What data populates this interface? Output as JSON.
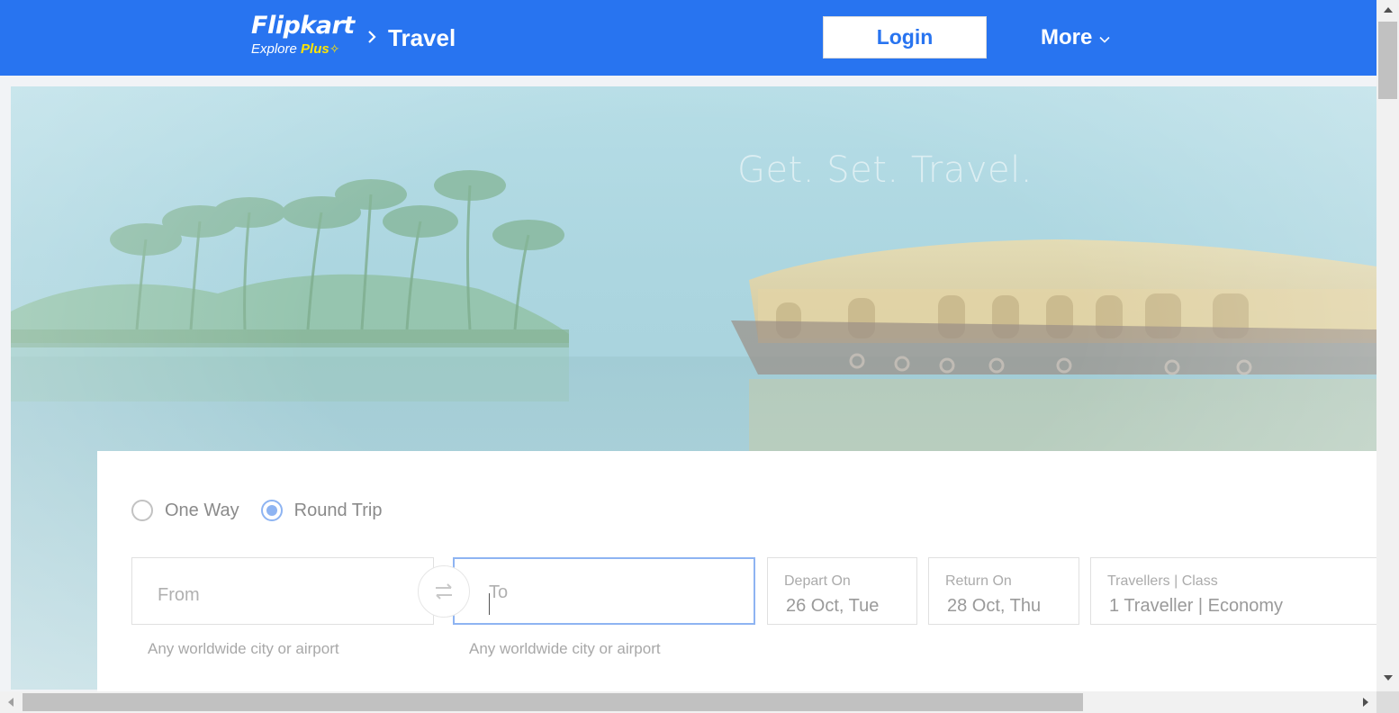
{
  "header": {
    "logo_main": "Flipkart",
    "logo_sub_explore": "Explore",
    "logo_sub_plus": "Plus",
    "breadcrumb_title": "Travel",
    "login_label": "Login",
    "more_label": "More",
    "brand_color": "#2874f0",
    "accent_color": "#ffe500"
  },
  "hero": {
    "tagline": "Get. Set. Travel."
  },
  "search": {
    "trip_types": [
      {
        "label": "One Way",
        "selected": false
      },
      {
        "label": "Round Trip",
        "selected": true
      }
    ],
    "from_placeholder": "From",
    "to_placeholder": "To",
    "from_hint": "Any worldwide city or airport",
    "to_hint": "Any worldwide city or airport",
    "depart_label": "Depart On",
    "depart_value": "26 Oct, Tue",
    "return_label": "Return On",
    "return_value": "28 Oct, Thu",
    "travellers_label": "Travellers | Class",
    "travellers_value": "1 Traveller | Economy"
  },
  "icons": {
    "breadcrumb_separator": "chevron-right-icon",
    "more_dropdown": "chevron-down-icon",
    "swap": "swap-arrows-icon"
  }
}
